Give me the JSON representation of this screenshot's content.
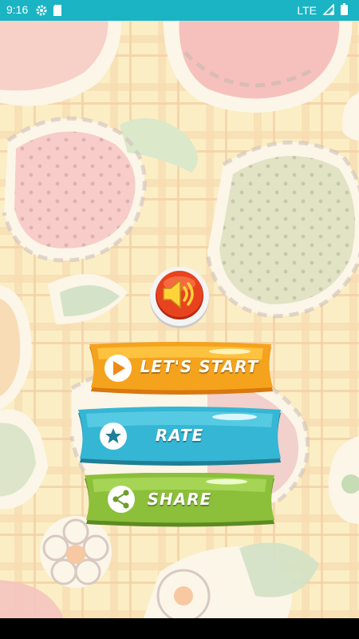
{
  "status_bar": {
    "time": "9:16",
    "network": "LTE",
    "background_color": "#1ab4c4"
  },
  "icons": {
    "settings": "gear-icon",
    "sd_card": "sd-card-icon",
    "signal": "signal-icon",
    "battery": "battery-icon",
    "sound": "speaker-icon",
    "play": "play-icon",
    "star": "star-icon",
    "share": "share-icon"
  },
  "menu": {
    "start_label": "LET'S START",
    "rate_label": "RATE",
    "share_label": "SHARE"
  },
  "colors": {
    "start_ribbon": "#f5a31d",
    "rate_ribbon": "#34b6d4",
    "share_ribbon": "#8cbf3a",
    "sound_button": "#e8431f",
    "background": "#fbeec5"
  }
}
